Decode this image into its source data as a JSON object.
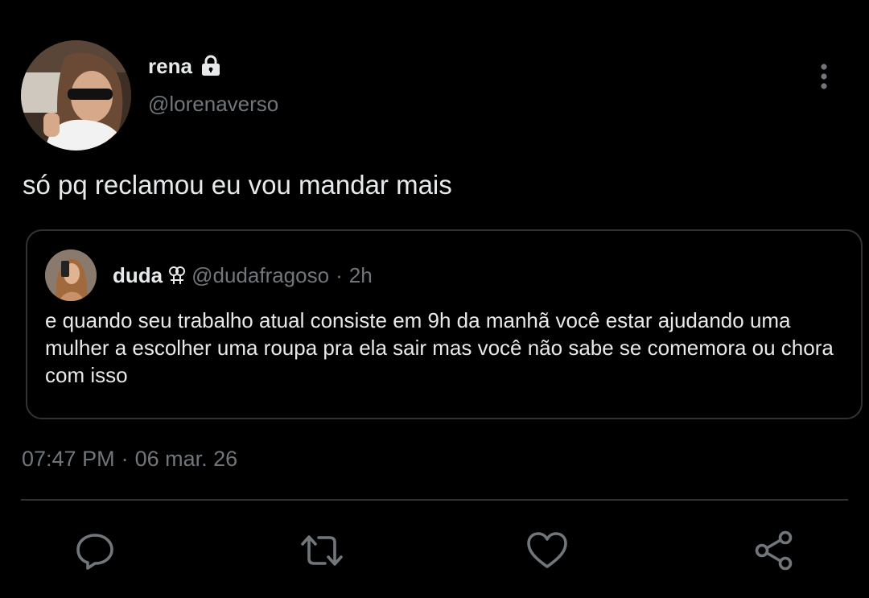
{
  "author": {
    "display_name": "rena",
    "handle": "@lorenaverso",
    "avatar_icon": "profile-photo",
    "protected_icon": "lock-icon"
  },
  "tweet": {
    "text": "só pq reclamou eu vou mandar mais",
    "time": "07:47 PM",
    "separator": "·",
    "date": "06 mar. 26"
  },
  "quoted_tweet": {
    "display_name": "duda",
    "name_icon": "venus-symbol-icon",
    "handle": "@dudafragoso",
    "separator": "·",
    "age": "2h",
    "text": "e quando seu trabalho atual consiste em 9h da manhã você estar ajudando uma mulher a escolher uma roupa pra ela sair mas você não sabe se comemora ou chora com isso"
  },
  "actions": [
    {
      "name": "reply",
      "icon": "reply-icon"
    },
    {
      "name": "retweet",
      "icon": "retweet-icon"
    },
    {
      "name": "like",
      "icon": "heart-icon"
    },
    {
      "name": "share",
      "icon": "share-icon"
    }
  ],
  "colors": {
    "background": "#000000",
    "primary_text": "#e7e9ea",
    "secondary_text": "#71767b",
    "border": "#2f3336"
  }
}
